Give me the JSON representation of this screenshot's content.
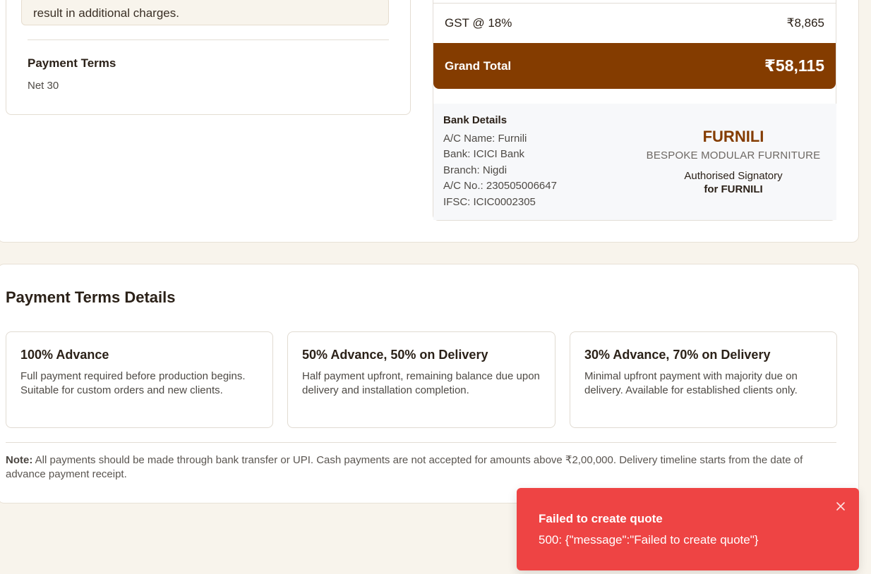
{
  "quote": {
    "note_text": "result in additional charges.",
    "payment_terms_label": "Payment Terms",
    "payment_terms_value": "Net 30"
  },
  "summary": {
    "gst_label": "GST @ 18%",
    "gst_value": "₹8,865",
    "grand_total_label": "Grand Total",
    "grand_total_value": "₹58,115"
  },
  "bank": {
    "title": "Bank Details",
    "lines": [
      "A/C Name: Furnili",
      "Bank: ICICI Bank",
      "Branch: Nigdi",
      "A/C No.: 230505006647",
      "IFSC: ICIC0002305"
    ]
  },
  "brand": {
    "name": "FURNILI",
    "tagline": "BESPOKE MODULAR FURNITURE",
    "signatory": "Authorised Signatory",
    "signatory_for": "for FURNILI"
  },
  "terms_details": {
    "title": "Payment Terms Details",
    "options": [
      {
        "title": "100% Advance",
        "description": "Full payment required before production begins. Suitable for custom orders and new clients."
      },
      {
        "title": "50% Advance, 50% on Delivery",
        "description": "Half payment upfront, remaining balance due upon delivery and installation completion."
      },
      {
        "title": "30% Advance, 70% on Delivery",
        "description": "Minimal upfront payment with majority due on delivery. Available for established clients only."
      }
    ],
    "note_label": "Note:",
    "note_text": " All payments should be made through bank transfer or UPI. Cash payments are not accepted for amounts above ₹2,00,000. Delivery timeline starts from the date of advance payment receipt."
  },
  "toast": {
    "title": "Failed to create quote",
    "message": "500: {\"message\":\"Failed to create quote\"}",
    "close_icon": "close-icon"
  },
  "colors": {
    "accent_brown": "#843c00",
    "toast_red": "#ee4444",
    "page_bg": "#f8f4ec"
  }
}
